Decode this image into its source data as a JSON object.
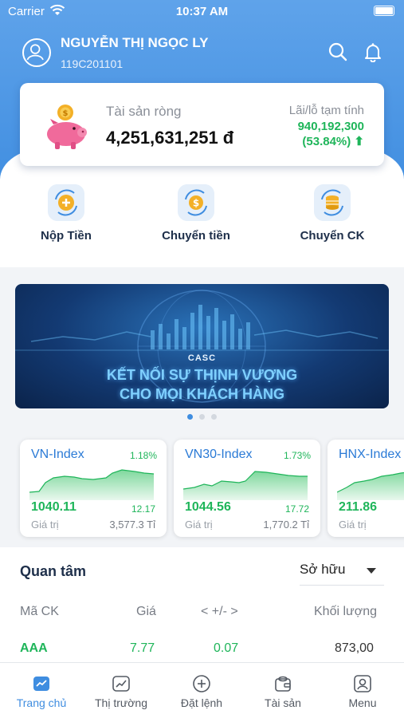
{
  "status_bar": {
    "carrier": "Carrier",
    "time": "10:37 AM"
  },
  "user": {
    "name": "NGUYỄN THỊ NGỌC LY",
    "account_id": "119C201101"
  },
  "assets": {
    "net_worth_label": "Tài sản ròng",
    "net_worth_value": "4,251,631,251 đ",
    "pl_label": "Lãi/lỗ tạm tính",
    "pl_value": "940,192,300",
    "pl_percent": "(53.84%) ⬆"
  },
  "quick_actions": [
    {
      "label": "Nộp Tiền",
      "icon": "deposit-icon"
    },
    {
      "label": "Chuyển tiền",
      "icon": "money-transfer-icon"
    },
    {
      "label": "Chuyển CK",
      "icon": "stock-transfer-icon"
    }
  ],
  "banner": {
    "brand": "CASC",
    "line1": "KẾT NỐI SỰ THỊNH VƯỢNG",
    "line2": "CHO MỌI KHÁCH HÀNG",
    "page_count": 3,
    "active_page": 1
  },
  "indices": [
    {
      "name": "VN-Index",
      "change_pct": "1.18%",
      "value": "1040.11",
      "volume": "12.17",
      "value_label": "Giá trị",
      "traded_value": "3,577.3 Tỉ"
    },
    {
      "name": "VN30-Index",
      "change_pct": "1.73%",
      "value": "1044.56",
      "volume": "17.72",
      "value_label": "Giá trị",
      "traded_value": "1,770.2 Tỉ"
    },
    {
      "name": "HNX-Index",
      "change_pct": "",
      "value": "211.86",
      "volume": "",
      "value_label": "Giá trị",
      "traded_value": ""
    }
  ],
  "watchlist": {
    "title": "Quan tâm",
    "filter_value": "Sở hữu",
    "columns": {
      "symbol": "Mã CK",
      "price": "Giá",
      "change": "< +/- >",
      "volume": "Khối lượng"
    },
    "rows": [
      {
        "symbol": "AAA",
        "price": "7.77",
        "change": "0.07",
        "volume": "873,00"
      }
    ]
  },
  "tabs": [
    {
      "label": "Trang chủ",
      "icon": "home-chart-icon",
      "active": true
    },
    {
      "label": "Thị trường",
      "icon": "market-icon",
      "active": false
    },
    {
      "label": "Đặt lệnh",
      "icon": "order-plus-icon",
      "active": false
    },
    {
      "label": "Tài sản",
      "icon": "wallet-icon",
      "active": false
    },
    {
      "label": "Menu",
      "icon": "menu-user-icon",
      "active": false
    }
  ],
  "colors": {
    "primary": "#3f8de0",
    "up": "#1fb55a",
    "text_dark": "#1e2f4a"
  }
}
